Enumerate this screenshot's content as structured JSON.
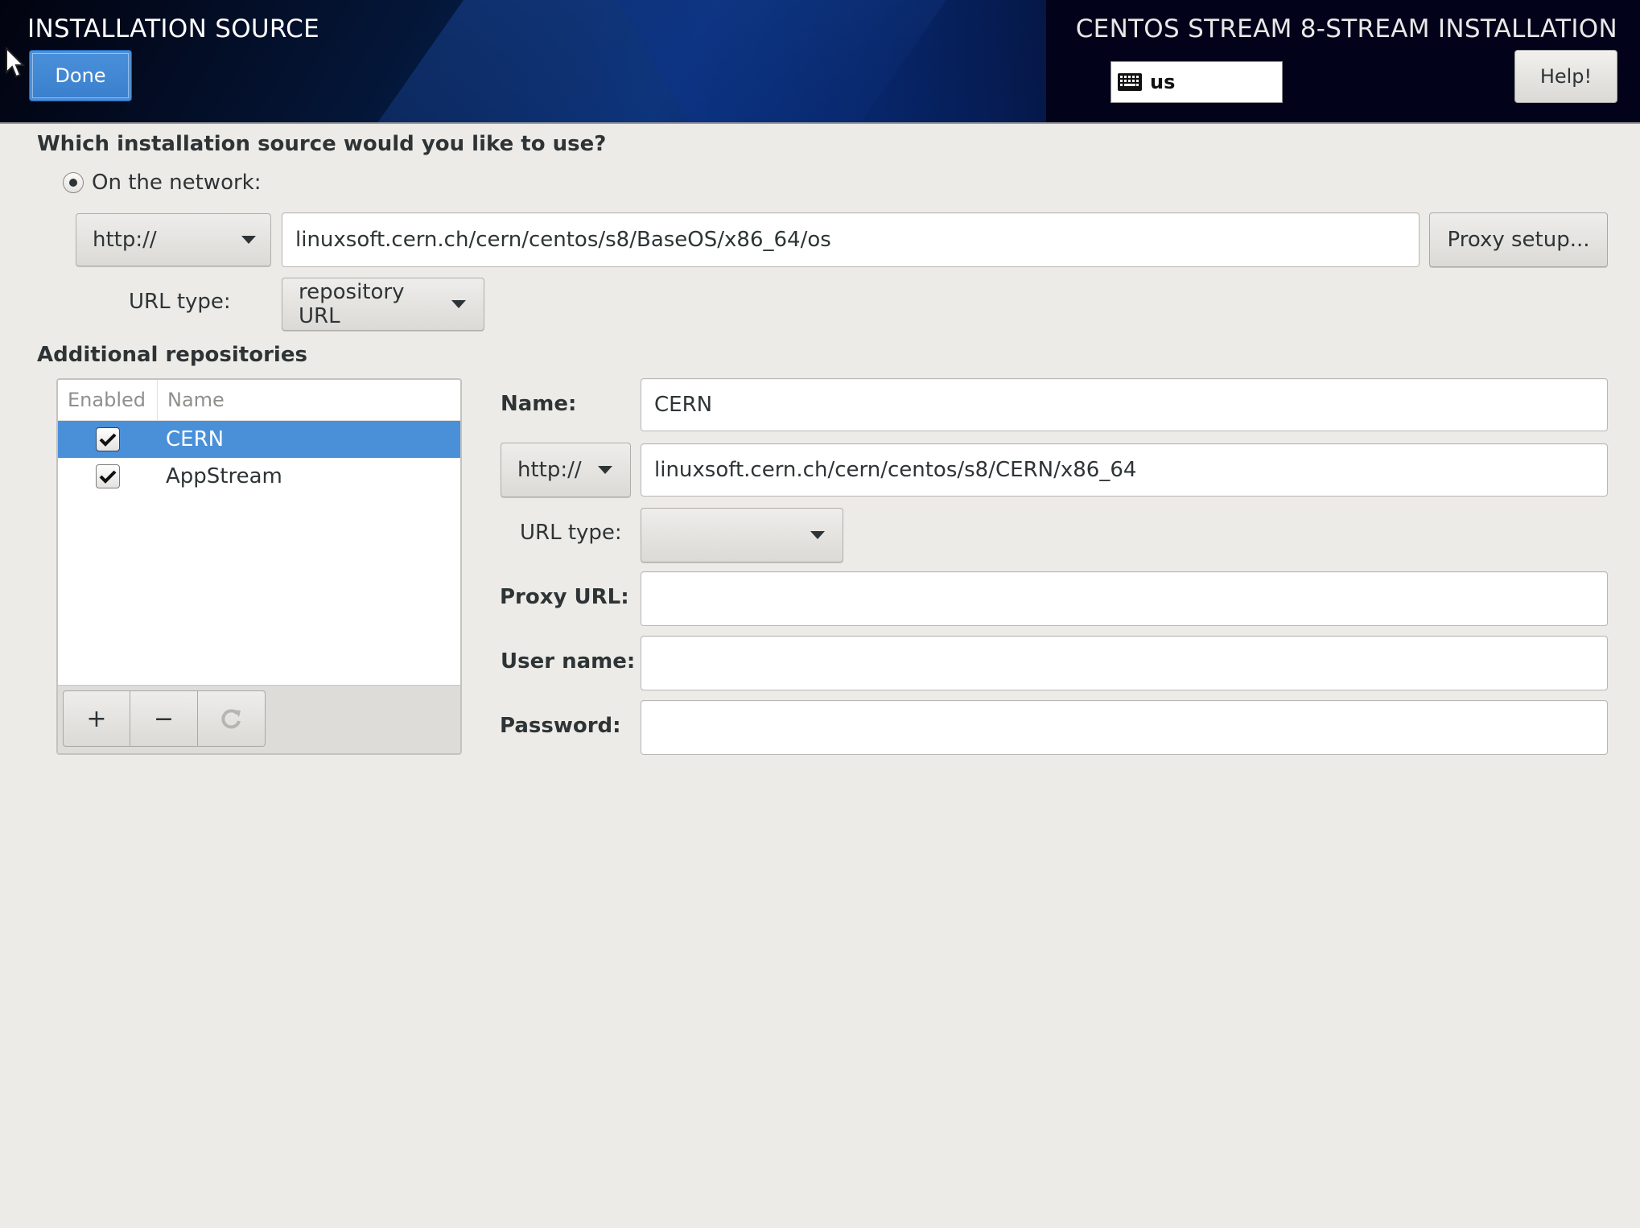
{
  "header": {
    "page_title": "INSTALLATION SOURCE",
    "product_title": "CENTOS STREAM 8-STREAM INSTALLATION",
    "done_label": "Done",
    "keyboard_layout": "us",
    "help_label": "Help!"
  },
  "source": {
    "question": "Which installation source would you like to use?",
    "network_option_label": "On the network:",
    "network_selected": true,
    "protocol": "http://",
    "url": "linuxsoft.cern.ch/cern/centos/s8/BaseOS/x86_64/os",
    "proxy_setup_label": "Proxy setup...",
    "url_type_label": "URL type:",
    "url_type": "repository URL"
  },
  "additional_repos": {
    "heading": "Additional repositories",
    "columns": [
      "Enabled",
      "Name"
    ],
    "rows": [
      {
        "enabled": true,
        "name": "CERN",
        "selected": true
      },
      {
        "enabled": true,
        "name": "AppStream",
        "selected": false
      }
    ],
    "toolbar": {
      "add_label": "+",
      "remove_label": "−"
    },
    "selection_color": "#4a90d9"
  },
  "repo_detail": {
    "name_label": "Name:",
    "name_value": "CERN",
    "protocol": "http://",
    "url": "linuxsoft.cern.ch/cern/centos/s8/CERN/x86_64",
    "url_type_label": "URL type:",
    "url_type": "",
    "proxy_url_label": "Proxy URL:",
    "proxy_url_value": "",
    "username_label": "User name:",
    "username_value": "",
    "password_label": "Password:",
    "password_value": ""
  }
}
